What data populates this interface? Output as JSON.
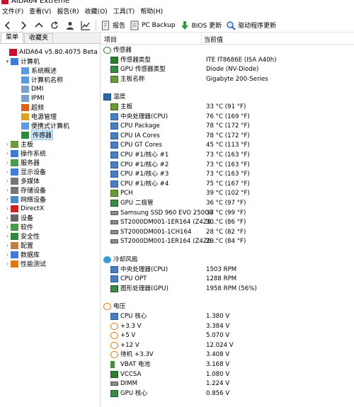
{
  "title": "AIDA64 Extreme",
  "menu": [
    "文件(F)",
    "查看(V)",
    "报告(R)",
    "收藏(O)",
    "工具(T)",
    "帮助(H)"
  ],
  "toolbar": {
    "report": "报告",
    "pc_backup": "PC Backup",
    "bios": "BIOS 更新",
    "driver": "驱动程序更新"
  },
  "tabs": [
    "菜单",
    "收藏夹"
  ],
  "tree": [
    {
      "label": "AIDA64 v5.80.4075 Beta",
      "level": 0,
      "exp": ""
    },
    {
      "label": "计算机",
      "level": 1,
      "exp": "▾"
    },
    {
      "label": "系统概述",
      "level": 2,
      "exp": ""
    },
    {
      "label": "计算机名称",
      "level": 2,
      "exp": ""
    },
    {
      "label": "DMI",
      "level": 2,
      "exp": ""
    },
    {
      "label": "IPMI",
      "level": 2,
      "exp": ""
    },
    {
      "label": "超频",
      "level": 2,
      "exp": ""
    },
    {
      "label": "电源管理",
      "level": 2,
      "exp": ""
    },
    {
      "label": "便携式计算机",
      "level": 2,
      "exp": ""
    },
    {
      "label": "传感器",
      "level": 2,
      "exp": "",
      "selected": true
    },
    {
      "label": "主板",
      "level": 1,
      "exp": "›"
    },
    {
      "label": "操作系统",
      "level": 1,
      "exp": "›"
    },
    {
      "label": "服务器",
      "level": 1,
      "exp": "›"
    },
    {
      "label": "显示设备",
      "level": 1,
      "exp": "›"
    },
    {
      "label": "多媒体",
      "level": 1,
      "exp": "›"
    },
    {
      "label": "存储设备",
      "level": 1,
      "exp": "›"
    },
    {
      "label": "网络设备",
      "level": 1,
      "exp": "›"
    },
    {
      "label": "DirectX",
      "level": 1,
      "exp": "›"
    },
    {
      "label": "设备",
      "level": 1,
      "exp": "›"
    },
    {
      "label": "软件",
      "level": 1,
      "exp": "›"
    },
    {
      "label": "安全性",
      "level": 1,
      "exp": "›"
    },
    {
      "label": "配置",
      "level": 1,
      "exp": "›"
    },
    {
      "label": "数据库",
      "level": 1,
      "exp": "›"
    },
    {
      "label": "性能测试",
      "level": 1,
      "exp": "›"
    }
  ],
  "columns": {
    "item": "项目",
    "value": "当前值"
  },
  "rows": [
    {
      "kind": "grp",
      "icon": "sensor",
      "name": "传感器",
      "value": ""
    },
    {
      "kind": "itm",
      "icon": "chip",
      "name": "传感器类型",
      "value": "ITE IT8686E  (ISA A40h)"
    },
    {
      "kind": "itm",
      "icon": "gpu",
      "name": "GPU 传感器类型",
      "value": "Diode  (NV-Diode)"
    },
    {
      "kind": "itm",
      "icon": "mb",
      "name": "主板名称",
      "value": "Gigabyte 200-Series"
    },
    {
      "kind": "gap"
    },
    {
      "kind": "grp",
      "icon": "temp",
      "name": "温度",
      "value": ""
    },
    {
      "kind": "itm",
      "icon": "mb",
      "name": "主板",
      "value": "33 °C  (91 °F)"
    },
    {
      "kind": "itm",
      "icon": "cpu",
      "name": "中央处理器(CPU)",
      "value": "76 °C  (169 °F)"
    },
    {
      "kind": "itm",
      "icon": "cpu",
      "name": "CPU Package",
      "value": "78 °C  (172 °F)"
    },
    {
      "kind": "itm",
      "icon": "cpu",
      "name": "CPU IA Cores",
      "value": "78 °C  (172 °F)"
    },
    {
      "kind": "itm",
      "icon": "cpu",
      "name": "CPU GT Cores",
      "value": "45 °C  (113 °F)"
    },
    {
      "kind": "itm",
      "icon": "cpu",
      "name": "CPU #1/核心 #1",
      "value": "73 °C  (163 °F)"
    },
    {
      "kind": "itm",
      "icon": "cpu",
      "name": "CPU #1/核心 #2",
      "value": "73 °C  (163 °F)"
    },
    {
      "kind": "itm",
      "icon": "cpu",
      "name": "CPU #1/核心 #3",
      "value": "73 °C  (163 °F)"
    },
    {
      "kind": "itm",
      "icon": "cpu",
      "name": "CPU #1/核心 #4",
      "value": "75 °C  (167 °F)"
    },
    {
      "kind": "itm",
      "icon": "mb",
      "name": "PCH",
      "value": "39 °C  (102 °F)"
    },
    {
      "kind": "itm",
      "icon": "gpu",
      "name": "GPU 二极管",
      "value": "36 °C  (97 °F)"
    },
    {
      "kind": "itm",
      "icon": "hdd",
      "name": "Samsung SSD 960 EVO 250GB",
      "value": "37 °C  (99 °F)"
    },
    {
      "kind": "itm",
      "icon": "hdd",
      "name": "ST2000DM001-1ER164 (Z4Z6...",
      "value": "30 °C  (86 °F)"
    },
    {
      "kind": "itm",
      "icon": "hdd",
      "name": "ST2000DM001-1CH164",
      "value": "28 °C  (82 °F)"
    },
    {
      "kind": "itm",
      "icon": "hdd",
      "name": "ST2000DM001-1ER164 (Z4Z6...",
      "value": "29 °C  (84 °F)"
    },
    {
      "kind": "gap"
    },
    {
      "kind": "grp",
      "icon": "fan",
      "name": "冷却风扇",
      "value": ""
    },
    {
      "kind": "itm",
      "icon": "cpu",
      "name": "中央处理器(CPU)",
      "value": "1503 RPM"
    },
    {
      "kind": "itm",
      "icon": "cpu",
      "name": "CPU OPT",
      "value": "1288 RPM"
    },
    {
      "kind": "itm",
      "icon": "gpu",
      "name": "图形处理器(GPU)",
      "value": "1958 RPM  (56%)"
    },
    {
      "kind": "gap"
    },
    {
      "kind": "grp",
      "icon": "volt",
      "name": "电压",
      "value": ""
    },
    {
      "kind": "itm",
      "icon": "cpu",
      "name": "CPU 核心",
      "value": "1.380 V"
    },
    {
      "kind": "itm",
      "icon": "volt",
      "name": "+3.3 V",
      "value": "3.384 V"
    },
    {
      "kind": "itm",
      "icon": "volt",
      "name": "+5 V",
      "value": "5.070 V"
    },
    {
      "kind": "itm",
      "icon": "volt",
      "name": "+12 V",
      "value": "12.024 V"
    },
    {
      "kind": "itm",
      "icon": "volt",
      "name": "待机 +3.3V",
      "value": "3.408 V"
    },
    {
      "kind": "itm",
      "icon": "bat",
      "name": "VBAT 电池",
      "value": "3.168 V"
    },
    {
      "kind": "itm",
      "icon": "chip",
      "name": "VCCSA",
      "value": "1.080 V"
    },
    {
      "kind": "itm",
      "icon": "hdd",
      "name": "DIMM",
      "value": "1.224 V"
    },
    {
      "kind": "itm",
      "icon": "gpu",
      "name": "GPU 核心",
      "value": "0.856 V"
    }
  ]
}
